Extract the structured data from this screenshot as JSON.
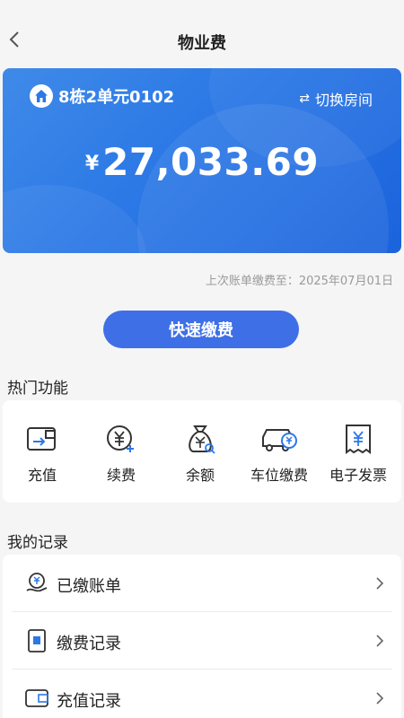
{
  "header": {
    "title": "物业费",
    "back_icon": "chevron-left-icon"
  },
  "account_card": {
    "house_icon": "home-icon",
    "house_name": "8栋2单元0102",
    "switch_icon": "swap-icon",
    "switch_label": "切换房间",
    "currency": "¥",
    "amount": "27,033.69",
    "accent_color": "#2b78e6"
  },
  "last_payment": "上次账单缴费至：2025年07月01日",
  "quick_pay_label": "快速缴费",
  "hot_section": {
    "title": "热门功能",
    "items": [
      {
        "label": "充值",
        "icon": "wallet-icon"
      },
      {
        "label": "续费",
        "icon": "yuan-renew-icon"
      },
      {
        "label": "余额",
        "icon": "money-bag-icon"
      },
      {
        "label": "车位缴费",
        "icon": "car-yuan-icon"
      },
      {
        "label": "电子发票",
        "icon": "receipt-icon"
      }
    ]
  },
  "records_section": {
    "title": "我的记录",
    "items": [
      {
        "label": "已缴账单",
        "icon": "paid-bill-icon"
      },
      {
        "label": "缴费记录",
        "icon": "payment-record-icon"
      },
      {
        "label": "充值记录",
        "icon": "recharge-record-icon"
      }
    ]
  }
}
